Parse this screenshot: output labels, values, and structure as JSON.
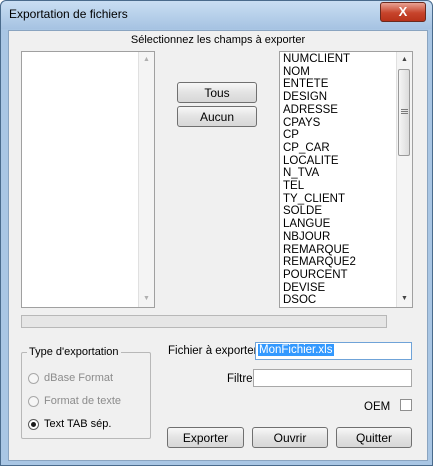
{
  "window": {
    "title": "Exportation de fichiers",
    "close_icon": "X"
  },
  "heading": "Sélectionnez les champs à exporter",
  "buttons": {
    "all": "Tous",
    "none": "Aucun",
    "export": "Exporter",
    "open": "Ouvrir",
    "quit": "Quitter"
  },
  "available_fields": [
    "NUMCLIENT",
    "NOM",
    "ENTETE",
    "DESIGN",
    "ADRESSE",
    "CPAYS",
    "CP",
    "CP_CAR",
    "LOCALITE",
    "N_TVA",
    "TEL",
    "TY_CLIENT",
    "SOLDE",
    "LANGUE",
    "NBJOUR",
    "REMARQUE",
    "REMARQUE2",
    "POURCENT",
    "DEVISE",
    "DSOC"
  ],
  "selected_fields": [],
  "export_type": {
    "legend": "Type d'exportation",
    "options": [
      {
        "label": "dBase Format",
        "enabled": false,
        "checked": false
      },
      {
        "label": "Format de texte",
        "enabled": false,
        "checked": false
      },
      {
        "label": "Text TAB sép.",
        "enabled": true,
        "checked": true
      }
    ]
  },
  "file": {
    "label": "Fichier à exporter:",
    "value": "MonFichier.xls"
  },
  "filter": {
    "label": "Filtre:",
    "value": ""
  },
  "oem": {
    "label": "OEM",
    "checked": false
  },
  "progress": 0,
  "icons": {
    "close": "close-icon",
    "scroll_up": "scroll-up-arrow-icon",
    "scroll_down": "scroll-down-arrow-icon"
  }
}
